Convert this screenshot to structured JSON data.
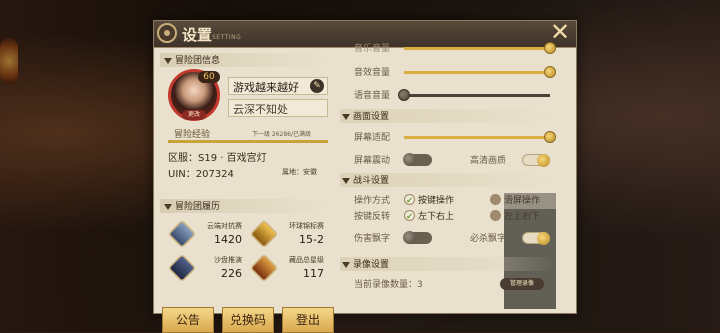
{
  "window": {
    "title": "设置",
    "subtitle": "SETTING",
    "close_icon": "close-icon"
  },
  "profile": {
    "section_title": "冒险团信息",
    "level": "60",
    "avatar_tag": "更改",
    "name": "游戏越来越好",
    "signature": "云深不知处",
    "exp_label": "冒险经验",
    "exp_detail": "下一级 26286/已满级",
    "exp_progress": 1.0,
    "server": "区服：S19 · 百戏宫灯",
    "uin": "UIN：207324",
    "location": "属地：安徽"
  },
  "history": {
    "section_title": "冒险团履历",
    "stats": [
      {
        "caption": "云端对抗赛",
        "value": "1420",
        "icon": "cloud-arena-icon"
      },
      {
        "caption": "环球锦标赛",
        "value": "15-2",
        "icon": "world-championship-icon"
      },
      {
        "caption": "沙盘推演",
        "value": "226",
        "icon": "sandbox-icon"
      },
      {
        "caption": "藏品总星级",
        "value": "117",
        "icon": "collection-star-icon"
      }
    ]
  },
  "buttons": {
    "notice": "公告",
    "redeem": "兑换码",
    "logout": "登出"
  },
  "audio": {
    "music_label": "音乐音量",
    "music_level": 1.0,
    "sfx_label": "音效音量",
    "sfx_level": 1.0,
    "voice_label": "语音音量",
    "voice_level": 0.0
  },
  "display": {
    "section_title": "画面设置",
    "fit_label": "屏幕适配",
    "fit_level": 1.0,
    "shake_label": "屏幕震动",
    "shake_on": false,
    "hq_label": "高清画质",
    "hq_on": true
  },
  "battle": {
    "section_title": "战斗设置",
    "mode_label": "操作方式",
    "mode_opt1": "按键操作",
    "mode_opt2": "滑屏操作",
    "reverse_label": "按键反转",
    "reverse_opt1": "左下右上",
    "reverse_opt2": "左上右下",
    "dmg_label": "伤害飘字",
    "dmg_on": false,
    "kill_label": "必杀飘字",
    "kill_on": true
  },
  "record": {
    "section_title": "录像设置",
    "count_text": "当前录像数量：3",
    "manage_label": "管理录像"
  }
}
